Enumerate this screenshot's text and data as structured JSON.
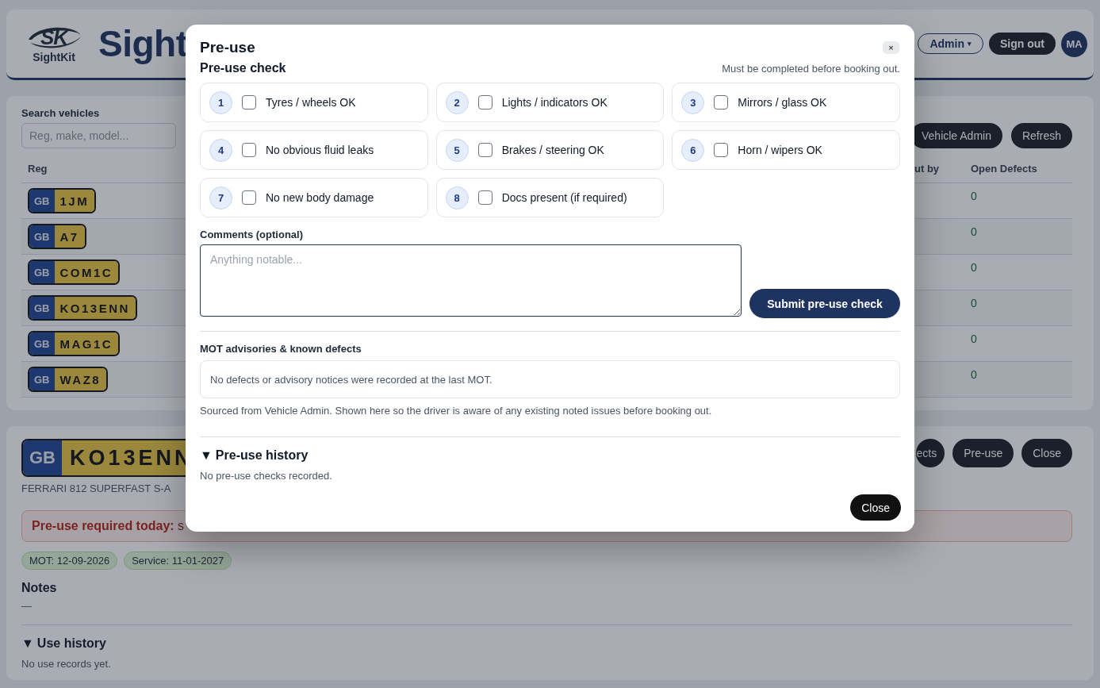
{
  "header": {
    "logo_text": "SK",
    "logo_caption": "SightKit",
    "title": "Sight",
    "admin_menu": "Admin",
    "admin_caret": "▾",
    "sign_out": "Sign out",
    "avatar": "MA"
  },
  "vehicles": {
    "search_label": "Search vehicles",
    "search_placeholder": "Reg, make, model...",
    "buttons": [
      "Vehicle Admin",
      "Refresh"
    ],
    "columns": [
      "Reg",
      "ut by",
      "Open Defects"
    ],
    "rows": [
      {
        "country": "GB",
        "reg": "1JM",
        "open_defects": "0"
      },
      {
        "country": "GB",
        "reg": "A7",
        "open_defects": "0"
      },
      {
        "country": "GB",
        "reg": "COM1C",
        "open_defects": "0"
      },
      {
        "country": "GB",
        "reg": "KO13ENN",
        "open_defects": "0"
      },
      {
        "country": "GB",
        "reg": "MAG1C",
        "open_defects": "0"
      },
      {
        "country": "GB",
        "reg": "WAZ8",
        "open_defects": "0"
      }
    ]
  },
  "detail": {
    "country": "GB",
    "reg": "KO13ENN",
    "model": "FERRARI 812 SUPERFAST S-A",
    "buttons": [
      "ects",
      "Pre-use",
      "Close"
    ],
    "alert": "**Pre-use required today:** s",
    "pills": [
      "MOT: 12-09-2026",
      "Service: 11-01-2027"
    ],
    "notes_heading": "Notes",
    "notes": "—",
    "use_history": {
      "marker": "▼",
      "title": "Use history",
      "empty": "No use records yet."
    }
  },
  "modal": {
    "title": "Pre-use",
    "close": "×",
    "section": "Pre-use check",
    "hint": "Must be completed before booking out.",
    "items": [
      {
        "number": "1",
        "label": "Tyres / wheels OK",
        "checked": false
      },
      {
        "number": "2",
        "label": "Lights / indicators OK",
        "checked": false
      },
      {
        "number": "3",
        "label": "Mirrors / glass OK",
        "checked": false
      },
      {
        "number": "4",
        "label": "No obvious fluid leaks",
        "checked": false
      },
      {
        "number": "5",
        "label": "Brakes / steering OK",
        "checked": false
      },
      {
        "number": "6",
        "label": "Horn / wipers OK",
        "checked": false
      },
      {
        "number": "7",
        "label": "No new body damage",
        "checked": false
      },
      {
        "number": "8",
        "label": "Docs present (if required)",
        "checked": false
      }
    ],
    "comments_label": "Comments (optional)",
    "comments_placeholder": "Anything notable...",
    "submit": "Submit pre-use check",
    "mot_heading": "MOT advisories & known defects",
    "mot_text": "No defects or advisory notices were recorded at the last MOT.",
    "mot_note": "Sourced from Vehicle Admin. Shown here so the driver is aware of any existing noted issues before booking out.",
    "history": {
      "marker": "▼",
      "title": "Pre-use history",
      "empty": "No pre-use checks recorded."
    },
    "close_button": "Close"
  }
}
